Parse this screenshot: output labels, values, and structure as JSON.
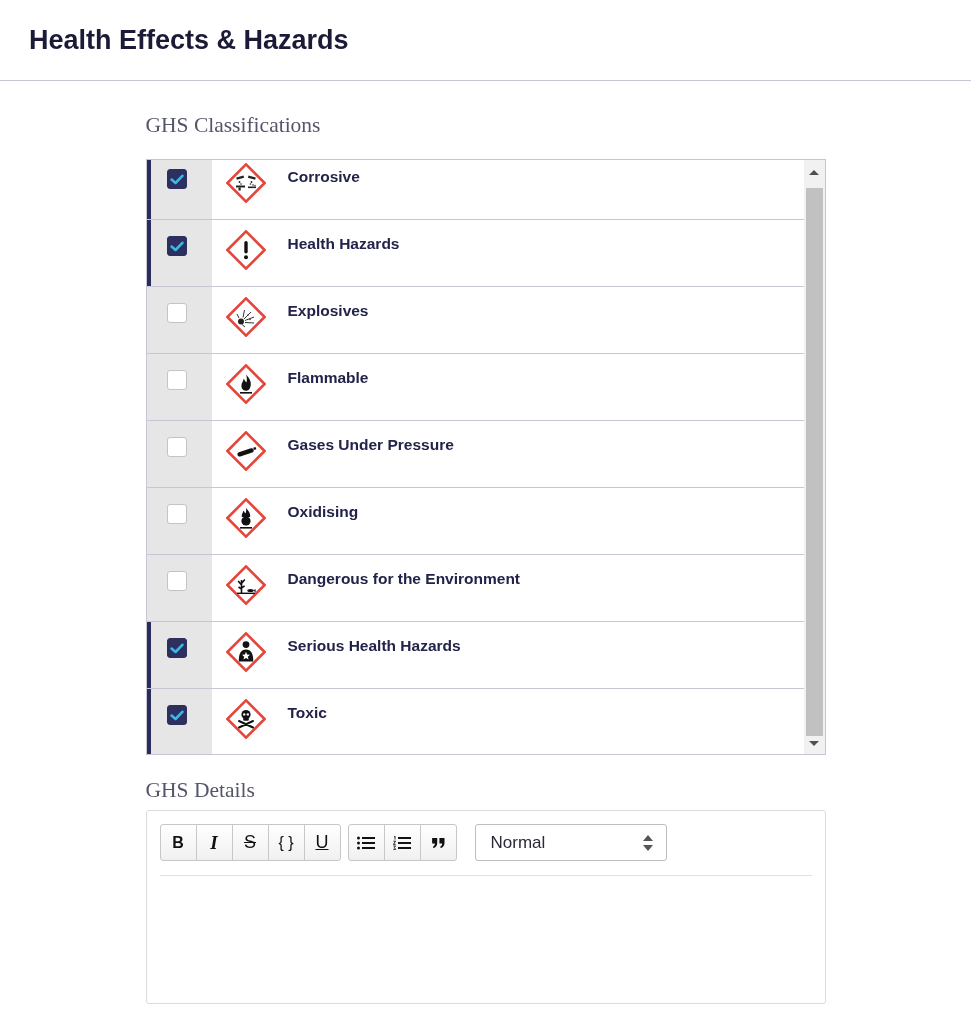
{
  "header": {
    "title": "Health Effects & Hazards"
  },
  "ghs_classifications": {
    "label": "GHS Classifications",
    "items": [
      {
        "label": "Corrosive",
        "checked": true,
        "kind": "corrosive"
      },
      {
        "label": "Health Hazards",
        "checked": true,
        "kind": "exclamation"
      },
      {
        "label": "Explosives",
        "checked": false,
        "kind": "explosive"
      },
      {
        "label": "Flammable",
        "checked": false,
        "kind": "flame"
      },
      {
        "label": "Gases Under Pressure",
        "checked": false,
        "kind": "cylinder"
      },
      {
        "label": "Oxidising",
        "checked": false,
        "kind": "oxidiser"
      },
      {
        "label": "Dangerous for the Environment",
        "checked": false,
        "kind": "environment"
      },
      {
        "label": "Serious Health Hazards",
        "checked": true,
        "kind": "health"
      },
      {
        "label": "Toxic",
        "checked": true,
        "kind": "skull"
      }
    ]
  },
  "ghs_details": {
    "label": "GHS Details",
    "toolbar": {
      "groups": [
        {
          "buttons": [
            {
              "kind": "bold",
              "text": "B"
            },
            {
              "kind": "italic",
              "text": "I"
            },
            {
              "kind": "strike",
              "text": "S"
            },
            {
              "kind": "code",
              "text": "{ }"
            },
            {
              "kind": "underline",
              "text": "U"
            }
          ]
        },
        {
          "buttons": [
            {
              "kind": "bullets"
            },
            {
              "kind": "numbered"
            },
            {
              "kind": "quote"
            }
          ]
        }
      ],
      "format_select": {
        "value": "Normal"
      }
    }
  }
}
